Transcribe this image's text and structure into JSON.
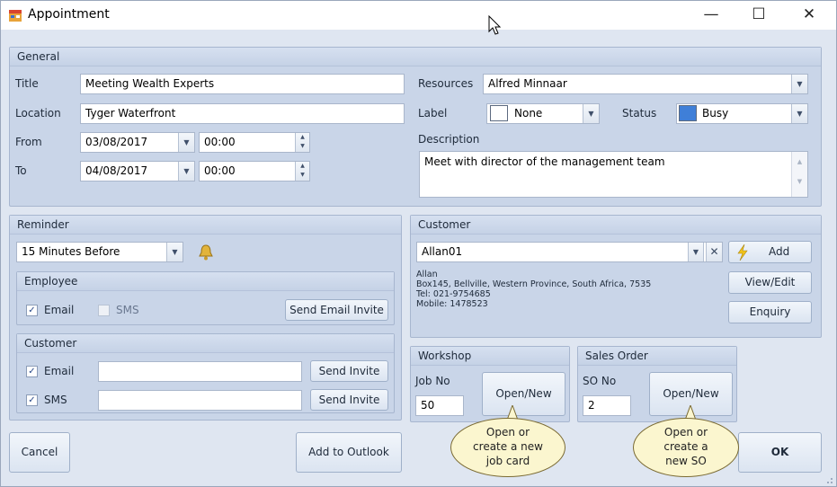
{
  "window": {
    "title": "Appointment",
    "controls": {
      "minimize": "—",
      "maximize": "☐",
      "close": "✕"
    }
  },
  "general": {
    "title": "General",
    "title_label": "Title",
    "title_value": "Meeting Wealth Experts",
    "location_label": "Location",
    "location_value": "Tyger Waterfront",
    "from_label": "From",
    "from_date": "03/08/2017",
    "from_time": "00:00",
    "to_label": "To",
    "to_date": "04/08/2017",
    "to_time": "00:00",
    "resources_label": "Resources",
    "resources_value": "Alfred Minnaar",
    "label_label": "Label",
    "label_value": "None",
    "label_color": "#ffffff",
    "status_label": "Status",
    "status_value": "Busy",
    "status_color": "#3f7fd8",
    "description_label": "Description",
    "description_value": "Meet with director of the management team"
  },
  "reminder": {
    "title": "Reminder",
    "value": "15 Minutes Before",
    "employee": {
      "title": "Employee",
      "email_label": "Email",
      "email_checked": true,
      "sms_label": "SMS",
      "sms_checked": false,
      "send_button": "Send Email Invite"
    },
    "customer": {
      "title": "Customer",
      "email_label": "Email",
      "email_checked": true,
      "email_value": "",
      "sms_label": "SMS",
      "sms_checked": true,
      "sms_value": "",
      "send_email_button": "Send Invite",
      "send_sms_button": "Send Invite"
    }
  },
  "customer": {
    "title": "Customer",
    "value": "Allan01",
    "info_lines": [
      "Allan",
      "Box145, Bellville, Western Province, South Africa, 7535",
      "Tel: 021-9754685",
      "Mobile: 1478523"
    ],
    "add_button": "Add",
    "view_edit_button": "View/Edit",
    "enquiry_button": "Enquiry"
  },
  "workshop": {
    "title": "Workshop",
    "job_no_label": "Job No",
    "job_no_value": "50",
    "open_new_button": "Open/New"
  },
  "sales_order": {
    "title": "Sales Order",
    "so_no_label": "SO No",
    "so_no_value": "2",
    "open_new_button": "Open/New"
  },
  "callouts": {
    "job_card": "Open or\ncreate a new\njob card",
    "sales_order": "Open or\ncreate a\nnew SO"
  },
  "footer": {
    "cancel": "Cancel",
    "add_to_outlook": "Add to Outlook",
    "ok": "OK"
  }
}
